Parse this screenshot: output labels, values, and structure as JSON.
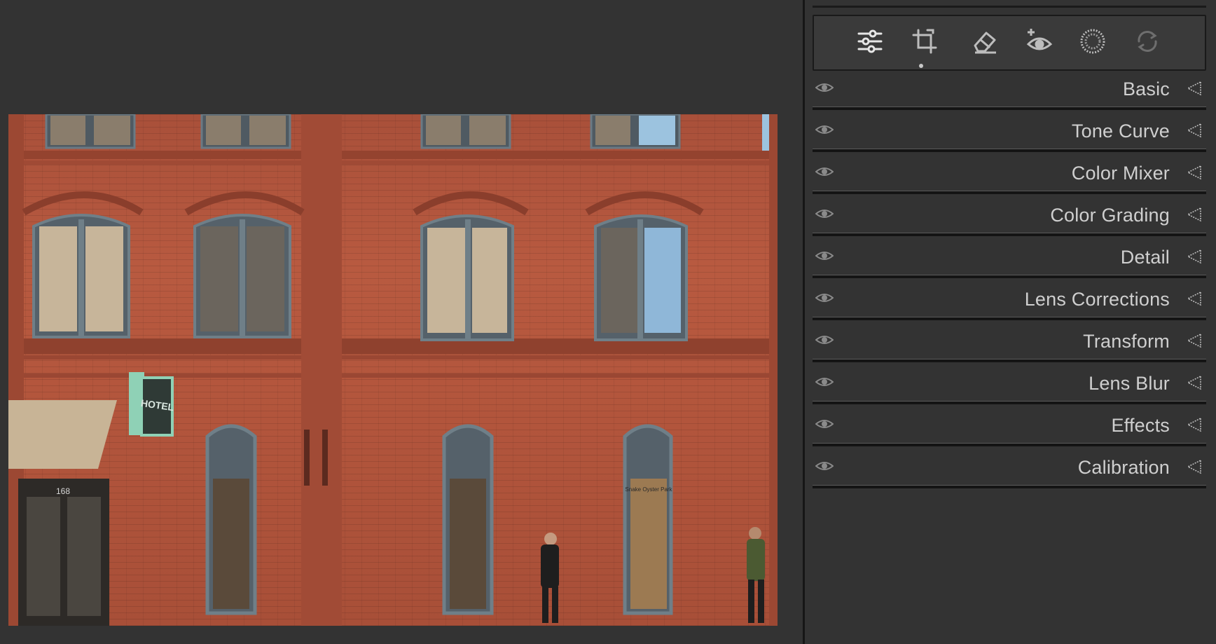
{
  "photo": {
    "sign_text": "HOTEL",
    "door_number": "168",
    "window_sign": "Snake Oyster Park"
  },
  "toolbar": {
    "tools": [
      {
        "icon": "edit-sliders-icon",
        "active": true
      },
      {
        "icon": "crop-icon",
        "active": false
      },
      {
        "icon": "eraser-icon",
        "active": false
      },
      {
        "icon": "red-eye-icon",
        "active": false
      },
      {
        "icon": "masking-icon",
        "active": false
      },
      {
        "icon": "presets-icon",
        "active": false
      }
    ]
  },
  "sections": [
    {
      "label": "Basic"
    },
    {
      "label": "Tone Curve"
    },
    {
      "label": "Color Mixer"
    },
    {
      "label": "Color Grading"
    },
    {
      "label": "Detail"
    },
    {
      "label": "Lens Corrections"
    },
    {
      "label": "Transform"
    },
    {
      "label": "Lens Blur"
    },
    {
      "label": "Effects"
    },
    {
      "label": "Calibration"
    }
  ],
  "colors": {
    "background": "#333333",
    "panel_text": "#cfcfcf",
    "separator": "#141414"
  }
}
